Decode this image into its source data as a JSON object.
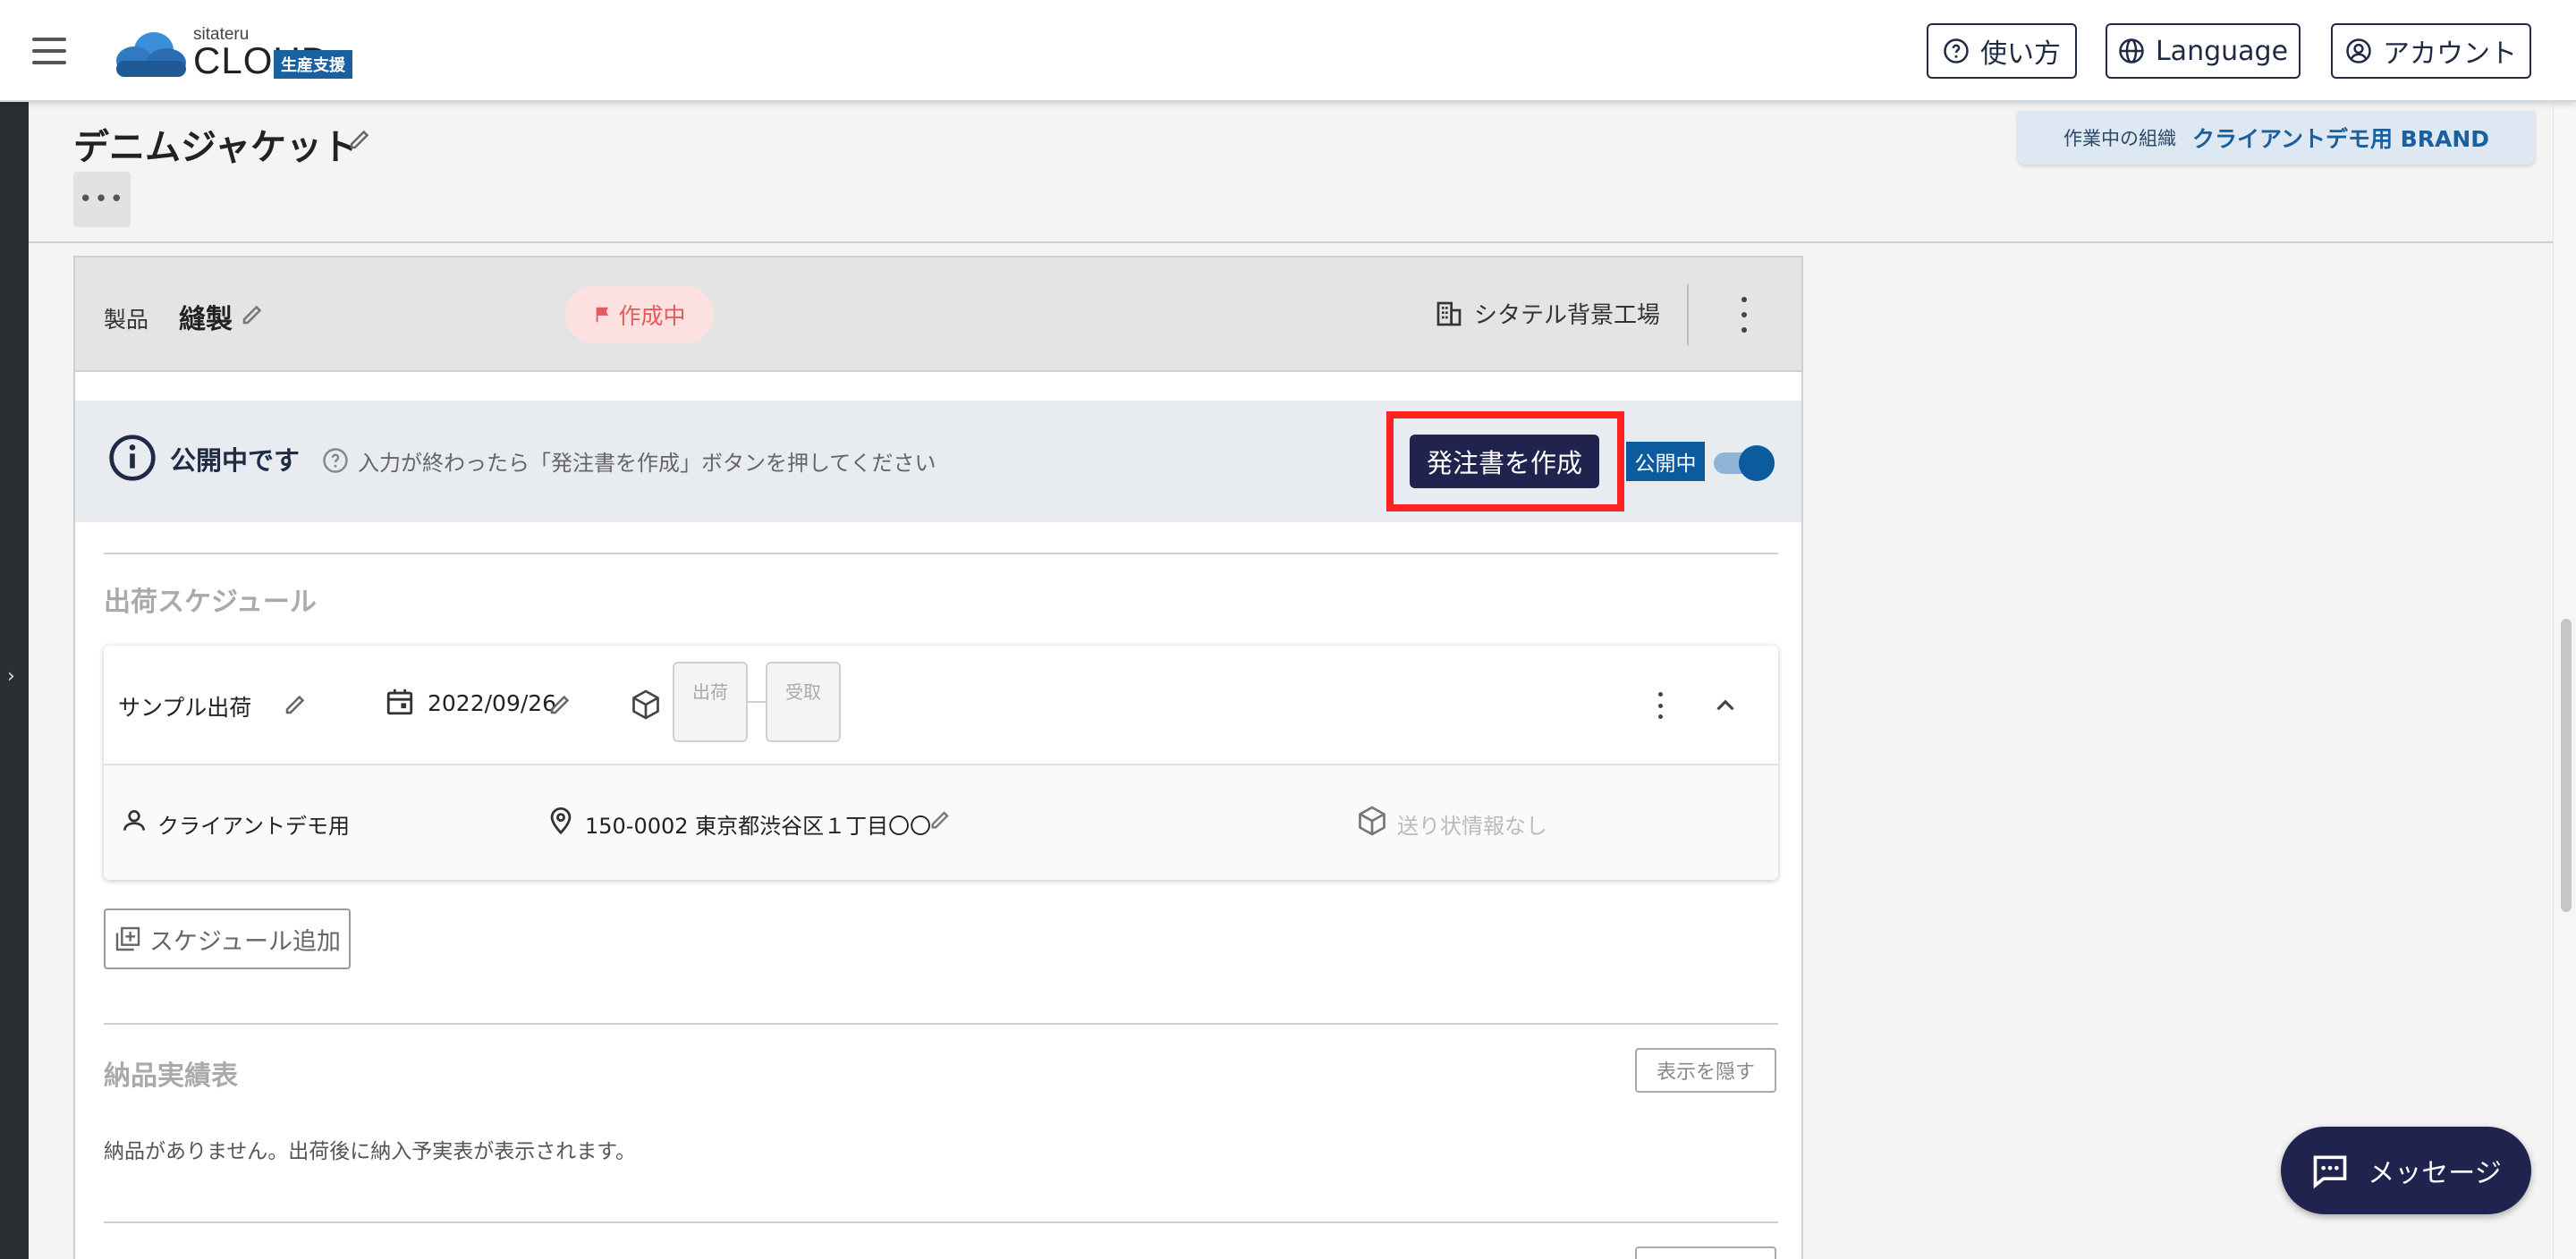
{
  "header": {
    "logo_small": "sitateru",
    "logo_big": "CLOUD",
    "logo_badge": "生産支援",
    "help_label": "使い方",
    "language_label": "Language",
    "account_label": "アカウント"
  },
  "page": {
    "title": "デニムジャケット",
    "more_label": "•••",
    "org_label": "作業中の組織",
    "org_name": "クライアントデモ用 BRAND"
  },
  "product": {
    "label": "製品",
    "name": "縫製",
    "status": "作成中",
    "factory": "シタテル背景工場"
  },
  "publish": {
    "status_text": "公開中です",
    "hint": "入力が終わったら「発注書を作成」ボタンを押してください",
    "order_button": "発注書を作成",
    "public_tag": "公開中",
    "toggle_on": true
  },
  "shipping": {
    "section_title": "出荷スケジュール",
    "schedule": {
      "name": "サンプル出荷",
      "date": "2022/09/26",
      "steps": [
        "出荷",
        "受取"
      ],
      "client": "クライアントデモ用",
      "address": "150-0002 東京都渋谷区１丁目〇〇",
      "invoice": "送り状情報なし"
    },
    "add_label": "スケジュール追加"
  },
  "delivery": {
    "section_title": "納品実績表",
    "hide_label": "表示を隠す",
    "empty_text": "納品がありません。出荷後に納入予実表が表示されます。"
  },
  "message": {
    "label": "メッセージ"
  },
  "colors": {
    "primary": "#20234e",
    "accent": "#0c5b9e",
    "highlight": "#ff2222",
    "status_bg": "#fde1e1",
    "status_text": "#e35a5a"
  }
}
